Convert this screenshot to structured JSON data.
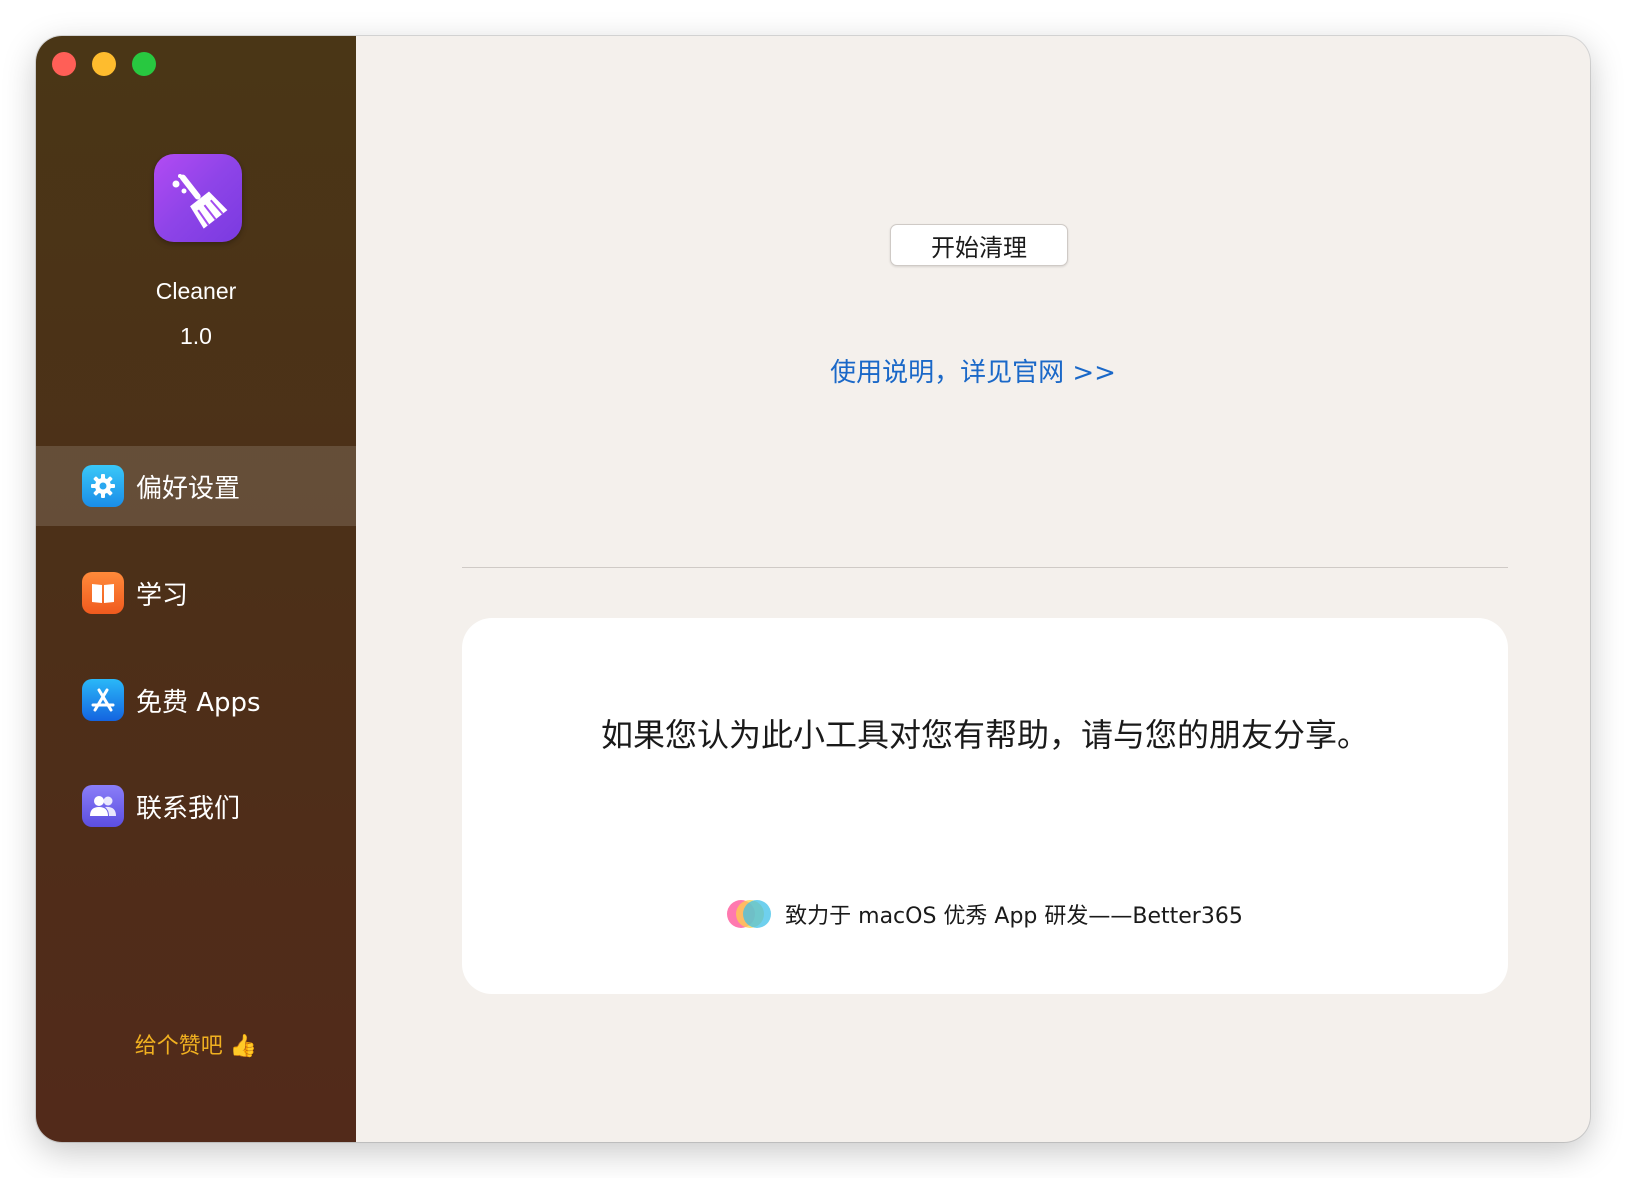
{
  "window": {
    "controls": [
      "close",
      "minimize",
      "zoom"
    ]
  },
  "sidebar": {
    "app_name": "Cleaner",
    "app_version": "1.0",
    "items": [
      {
        "label": "偏好设置",
        "icon": "gear-icon",
        "active": true
      },
      {
        "label": "学习",
        "icon": "book-icon",
        "active": false
      },
      {
        "label": "免费 Apps",
        "icon": "app-store-icon",
        "active": false
      },
      {
        "label": "联系我们",
        "icon": "people-icon",
        "active": false
      }
    ],
    "like_label": "给个赞吧 👍"
  },
  "main": {
    "start_button": "开始清理",
    "help_link": "使用说明，详见官网 >>",
    "share_message": "如果您认为此小工具对您有帮助，请与您的朋友分享。",
    "footer_text": "致力于 macOS 优秀 App 研发——Better365"
  },
  "colors": {
    "sidebar_top": "#4a3616",
    "sidebar_bottom": "#522a1a",
    "main_bg": "#f4f0ec",
    "link": "#1a68c8",
    "like": "#f0b020"
  }
}
